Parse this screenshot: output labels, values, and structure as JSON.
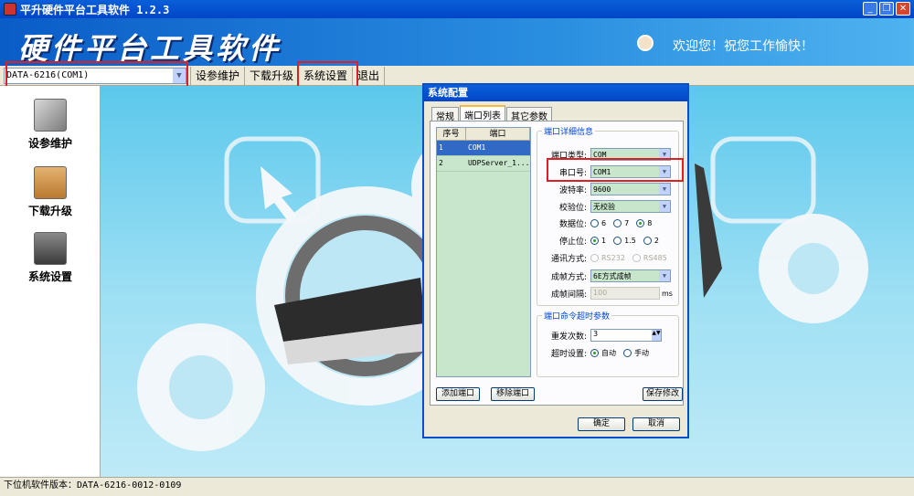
{
  "window": {
    "title": "平升硬件平台工具软件 1.2.3"
  },
  "banner": {
    "app_name": "硬件平台工具软件",
    "welcome": "欢迎您！祝您工作愉快！"
  },
  "toolbar": {
    "device": "DATA-6216(COM1)",
    "menu": [
      "设参维护",
      "下载升级",
      "系统设置",
      "退出"
    ]
  },
  "sidebar": {
    "items": [
      {
        "label": "设参维护",
        "icon": "tools-icon"
      },
      {
        "label": "下载升级",
        "icon": "download-box-icon"
      },
      {
        "label": "系统设置",
        "icon": "settings-panel-icon"
      }
    ]
  },
  "statusbar": {
    "text": "下位机软件版本：DATA-6216-0012-0109"
  },
  "dialog": {
    "title": "系统配置",
    "tabs": [
      "常规",
      "端口列表",
      "其它参数"
    ],
    "active_tab": "端口列表",
    "port_list": {
      "headers": [
        "序号",
        "端口"
      ],
      "rows": [
        {
          "no": "1",
          "port": "COM1"
        },
        {
          "no": "2",
          "port": "UDPServer_1..."
        }
      ]
    },
    "detail": {
      "title": "端口详细信息",
      "port_type_label": "端口类型:",
      "port_type": "COM",
      "com_label": "串口号:",
      "com": "COM1",
      "baud_label": "波特率:",
      "baud": "9600",
      "parity_label": "校验位:",
      "parity": "无校验",
      "databits_label": "数据位:",
      "databits": [
        "6",
        "7",
        "8"
      ],
      "databits_selected": "8",
      "stopbits_label": "停止位:",
      "stopbits": [
        "1",
        "1.5",
        "2"
      ],
      "stopbits_selected": "1",
      "comm_label": "通讯方式:",
      "comm": [
        "RS232",
        "RS485"
      ],
      "frame_label": "成帧方式:",
      "frame": "6E方式成帧",
      "interval_label": "成帧间隔:",
      "interval": "100",
      "interval_unit": "ms"
    },
    "timeout": {
      "title": "端口命令超时参数",
      "retry_label": "重发次数:",
      "retry": "3",
      "timeout_label": "超时设置:",
      "options": [
        "自动",
        "手动"
      ],
      "selected": "自动"
    },
    "buttons": {
      "add": "添加端口",
      "remove": "移除端口",
      "save": "保存修改",
      "ok": "确定",
      "cancel": "取消"
    }
  }
}
